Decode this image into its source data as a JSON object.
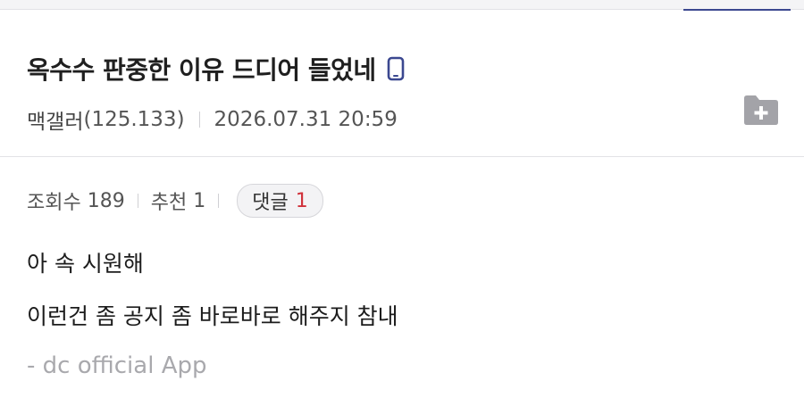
{
  "post": {
    "title": "옥수수 판중한 이유 드디어 들었네",
    "writer": "맥갤러",
    "ip": "(125.133)",
    "date": "2026.07.31 20:59"
  },
  "stats": {
    "views_label": "조회수",
    "views": "189",
    "recommend_label": "추천",
    "recommend": "1",
    "comment_label": "댓글",
    "comment_count": "1"
  },
  "content": {
    "lines": [
      "아 속 시원해",
      "이런건 좀 공지 좀 바로바로 해주지 참내"
    ],
    "signature": "- dc official App"
  },
  "icons": {
    "title_device": "phone-icon",
    "save": "folder-plus-icon"
  },
  "colors": {
    "accent": "#3b4890",
    "comment_count": "#d0313a",
    "signature": "#a9a9ad"
  }
}
